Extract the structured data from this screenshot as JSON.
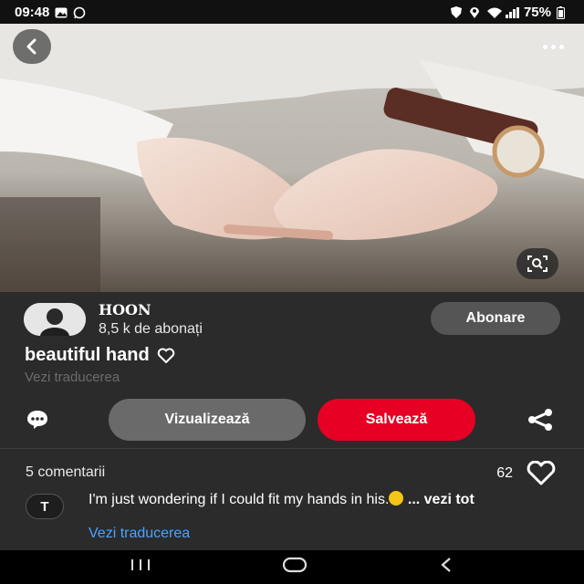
{
  "status": {
    "time": "09:48",
    "battery": "75%"
  },
  "author": {
    "name": "HOON",
    "followers": "8,5 k de abonați",
    "follow_label": "Abonare"
  },
  "pin": {
    "title": "beautiful hand",
    "see_translation": "Vezi traducerea"
  },
  "actions": {
    "view_label": "Vizualizează",
    "save_label": "Salvează"
  },
  "comments": {
    "count_label": "5 comentarii",
    "likes": "62",
    "items": [
      {
        "avatar_letter": "T",
        "text": "I'm just wondering if I could fit my hands in his.",
        "more_label": "... vezi tot",
        "translate_label": "Vezi traducerea"
      }
    ]
  },
  "colors": {
    "save": "#e60023",
    "link": "#4aa3ff"
  },
  "icons": [
    "back-icon",
    "more-icon",
    "visual-search-icon",
    "comment-icon",
    "heart-icon",
    "share-icon"
  ]
}
